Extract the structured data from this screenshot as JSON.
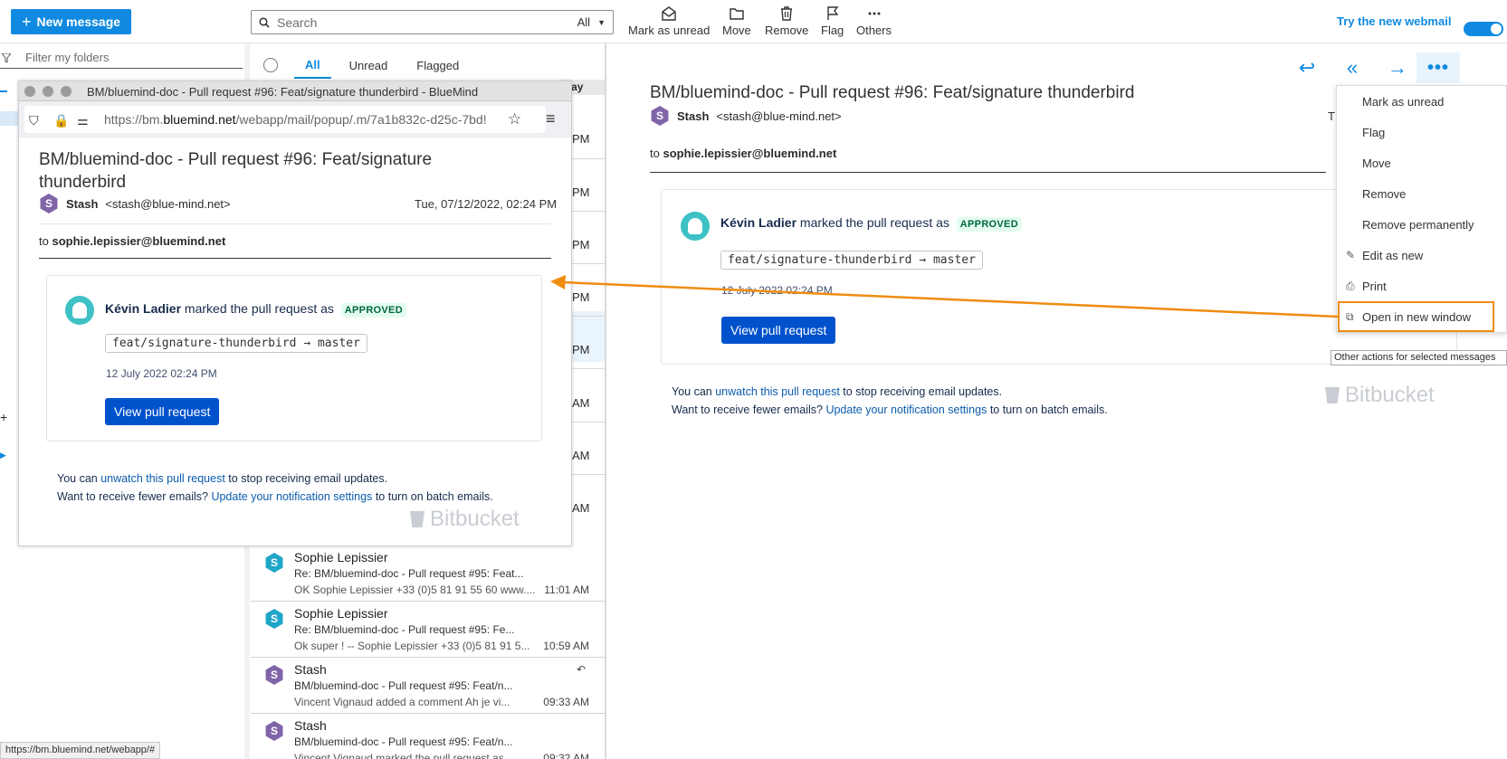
{
  "toolbar": {
    "new_message": "New message",
    "search_placeholder": "Search",
    "search_scope": "All",
    "actions": [
      "Mark as unread",
      "Move",
      "Remove",
      "Flag",
      "Others"
    ],
    "try_new": "Try the new webmail"
  },
  "folders": {
    "filter_placeholder": "Filter my folders"
  },
  "list": {
    "tabs": [
      "All",
      "Unread",
      "Flagged"
    ],
    "today_label": "Today",
    "hidden_times": [
      "PM",
      "PM",
      "PM",
      "PM",
      "PM",
      "AM",
      "AM",
      "AM"
    ],
    "rows": [
      {
        "initial": "S",
        "sender": "Sophie Lepissier",
        "subject": "Re: BM/bluemind-doc - Pull request #95: Feat...",
        "preview": "OK Sophie Lepissier +33 (0)5 81 91 55 60 www....",
        "time": "11:01 AM"
      },
      {
        "initial": "S",
        "sender": "Sophie Lepissier",
        "subject": "Re: BM/bluemind-doc - Pull request #95: Fe...",
        "preview": "Ok super ! -- Sophie Lepissier +33 (0)5 81 91 5...",
        "time": "10:59 AM"
      },
      {
        "initial": "S",
        "sender": "Stash",
        "subject": "BM/bluemind-doc - Pull request #95: Feat/n...",
        "preview": "Vincent Vignaud added a comment Ah je vi...",
        "time": "09:33 AM"
      },
      {
        "initial": "S",
        "sender": "Stash",
        "subject": "BM/bluemind-doc - Pull request #95: Feat/n...",
        "preview": "Vincent Vignaud marked the pull request as...",
        "time": "09:32 AM"
      }
    ]
  },
  "message": {
    "subject": "BM/bluemind-doc - Pull request #96: Feat/signature thunderbird",
    "sender_initial": "S",
    "sender_name": "Stash",
    "sender_email": "<stash@blue-mind.net>",
    "date": "Tue, 07/12/2022, 02:24 PM",
    "date_partial": "T",
    "to_label": "to",
    "to": "sophie.lepissier@bluemind.net",
    "actor": "Kévin Ladier",
    "action_text": "marked the pull request as",
    "badge": "APPROVED",
    "branch": "feat/signature-thunderbird → master",
    "when": "12 July 2022 02:24 PM",
    "cta": "View pull request",
    "footer1_pre": "You can",
    "footer1_link": "unwatch this pull request",
    "footer1_post": "to stop receiving email updates.",
    "footer2_pre": "Want to receive fewer emails?",
    "footer2_link": "Update your notification settings",
    "footer2_post": "to turn on batch emails.",
    "brand": "Bitbucket"
  },
  "dropdown": {
    "items": [
      "Mark as unread",
      "Flag",
      "Move",
      "Remove",
      "Remove permanently",
      "Edit as new",
      "Print",
      "Open in new window"
    ],
    "tooltip": "Other actions for selected messages"
  },
  "popup": {
    "window_title": "BM/bluemind-doc - Pull request #96: Feat/signature thunderbird - BlueMind",
    "url_prefix": "https://bm.",
    "url_domain": "bluemind.net",
    "url_suffix": "/webapp/mail/popup/.m/7a1b832c-d25c-7bd!",
    "subject": "BM/bluemind-doc - Pull request #96: Feat/signature thunderbird"
  },
  "status_url": "https://bm.bluemind.net/webapp/#",
  "colors": {
    "accent": "#0f8ae0",
    "annotation": "#f08c12",
    "cta": "#0052cc"
  }
}
